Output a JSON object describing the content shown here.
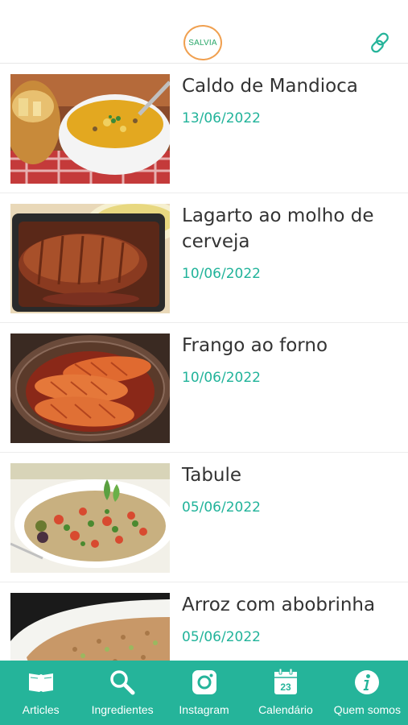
{
  "header": {
    "logo_text": "SALVIA",
    "link_icon": "link-icon"
  },
  "articles": [
    {
      "title": "Caldo de Mandioca",
      "date": "13/06/2022",
      "image": "soup-bowl-photo"
    },
    {
      "title": "Lagarto ao molho de cerveja",
      "date": "10/06/2022",
      "image": "roast-beef-photo"
    },
    {
      "title": "Frango ao forno",
      "date": "10/06/2022",
      "image": "baked-chicken-photo"
    },
    {
      "title": "Tabule",
      "date": "05/06/2022",
      "image": "tabbouleh-salad-photo"
    },
    {
      "title": "Arroz com abobrinha",
      "date": "05/06/2022",
      "image": "rice-zucchini-photo"
    }
  ],
  "tabs": [
    {
      "label": "Articles",
      "icon": "book-icon"
    },
    {
      "label": "Ingredientes",
      "icon": "search-icon"
    },
    {
      "label": "Instagram",
      "icon": "instagram-icon"
    },
    {
      "label": "Calendário",
      "icon": "calendar-icon",
      "calendar_day": "23"
    },
    {
      "label": "Quem somos",
      "icon": "info-icon"
    }
  ],
  "colors": {
    "accent": "#25b49a",
    "date": "#21b39a",
    "title": "#333333"
  }
}
